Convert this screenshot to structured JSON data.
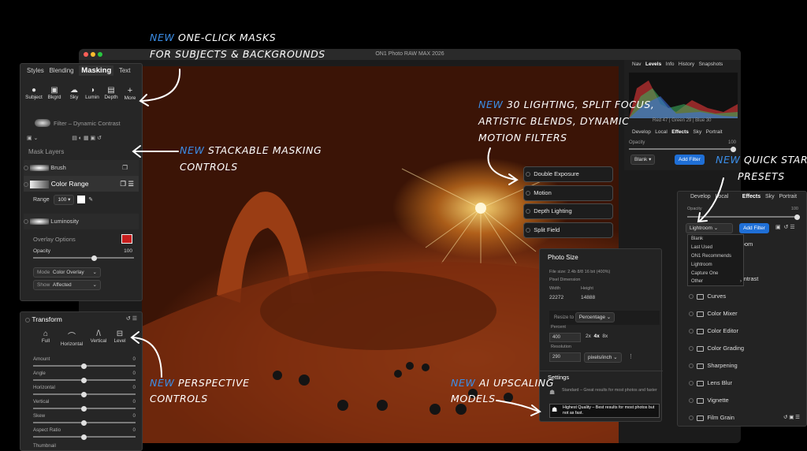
{
  "annotations": [
    {
      "new": "NEW",
      "text": "ONE-CLICK MASKS"
    },
    {
      "text": "FOR SUBJECTS & BACKGROUNDS"
    },
    {
      "new": "NEW",
      "text": "30 LIGHTING, SPLIT FOCUS,"
    },
    {
      "text": "ARTISTIC BLENDS, DYNAMIC"
    },
    {
      "text": "MOTION FILTERS"
    },
    {
      "new": "NEW",
      "text": "STACKABLE MASKING"
    },
    {
      "text": "CONTROLS"
    },
    {
      "new": "NEW",
      "text": "QUICK START"
    },
    {
      "text": "PRESETS"
    },
    {
      "new": "NEW",
      "text": "PERSPECTIVE"
    },
    {
      "text": "CONTROLS"
    },
    {
      "new": "NEW",
      "text": "AI UPSCALING"
    },
    {
      "text": "MODELS"
    }
  ],
  "window_title": "ON1 Photo RAW MAX 2026",
  "colors": {
    "accent": "#1f6fd6",
    "annotation_new": "#3b8ee8",
    "overlay": "#c81e1e"
  },
  "masking": {
    "tabs": [
      "Styles",
      "Blending",
      "Masking",
      "Text"
    ],
    "tools": [
      "Subject",
      "Bkgrd",
      "Sky",
      "Lumin",
      "Depth",
      "More"
    ],
    "filter_label": "Filter – Dynamic Contrast",
    "mask_layers_label": "Mask Layers",
    "layers": [
      "Brush",
      "Color Range",
      "Luminosity"
    ],
    "range_label": "Range",
    "range_value": "100",
    "overlay_label": "Overlay Options",
    "opacity_label": "Opacity",
    "opacity_value": "100",
    "mode_label": "Mode",
    "mode_value": "Color Overlay",
    "show_label": "Show",
    "show_value": "Affected"
  },
  "transform": {
    "title": "Transform",
    "tools": [
      "Full",
      "Horizontal",
      "Vertical",
      "Level"
    ],
    "sliders": [
      {
        "label": "Amount",
        "value": "0"
      },
      {
        "label": "Angle",
        "value": "0"
      },
      {
        "label": "Horizontal",
        "value": "0"
      },
      {
        "label": "Vertical",
        "value": "0"
      },
      {
        "label": "Skew",
        "value": "0"
      },
      {
        "label": "Aspect Ratio",
        "value": "0"
      },
      {
        "label": "Thumbnail",
        "value": ""
      }
    ]
  },
  "right": {
    "top_tabs": [
      "Nav",
      "Levels",
      "Info",
      "History",
      "Snapshots"
    ],
    "levels_readout": "Red 47 | Green 29 | Blue 30",
    "mid_tabs": [
      "Develop",
      "Local",
      "Effects",
      "Sky",
      "Portrait"
    ],
    "opacity_label": "Opacity",
    "opacity_value": "100",
    "blank_label": "Blank",
    "add_filter": "Add Filter"
  },
  "effects_buttons": [
    "Double Exposure",
    "Motion",
    "Depth Lighting",
    "Split Field"
  ],
  "photo_size": {
    "title": "Photo Size",
    "file_size": "File size: 2.4b 8/8 16 bit (400%)",
    "pixel_dim": "Pixel Dimension",
    "width_label": "Width",
    "height_label": "Height",
    "width": "22272",
    "height": "14888",
    "resize_label": "Resize to",
    "resize_value": "Percentage",
    "percent_label": "Percent",
    "percent_value": "400",
    "scales": [
      "2x",
      "4x",
      "8x"
    ],
    "resolution_label": "Resolution",
    "resolution_value": "290",
    "resolution_unit": "pixels/inch",
    "settings_title": "Settings",
    "standard": "Standard – Great results for most photos and faster",
    "highest": "Highest Quality – Best results for most photos but not as fast."
  },
  "effects_panel": {
    "tabs": [
      "Develop",
      "Local",
      "Effects",
      "Sky",
      "Portrait"
    ],
    "opacity_label": "Opacity",
    "opacity_value": "100",
    "preset": "Lightroom",
    "add_filter": "Add Filter",
    "dropdown": [
      "Blank",
      "Last Used",
      "ON1 Recommends",
      "Lightroom",
      "Capture One",
      "Other"
    ],
    "partial_items": [
      "Bloom",
      "Contrast"
    ],
    "filters": [
      "Curves",
      "Color Mixer",
      "Color Editor",
      "Color Grading",
      "Sharpening",
      "Lens Blur",
      "Vignette",
      "Film Grain"
    ]
  }
}
